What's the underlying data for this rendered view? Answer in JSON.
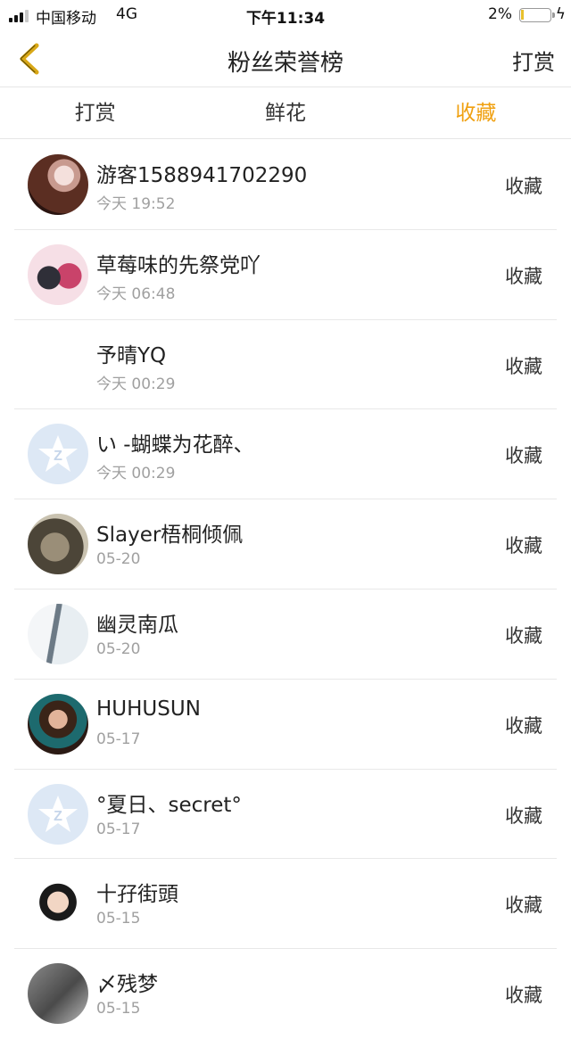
{
  "status_bar": {
    "carrier": "中国移动",
    "network": "4G",
    "time": "下午11:34",
    "battery_percent": "2%",
    "battery_level": 0.02,
    "signal_bars": 3,
    "accent_color": "#e8c02c"
  },
  "header": {
    "back_icon": "chevron-left-icon",
    "back_color": "#d9a817",
    "title": "粉丝荣誉榜",
    "right_action": "打赏"
  },
  "tabs": [
    {
      "label": "打赏",
      "active": false
    },
    {
      "label": "鲜花",
      "active": false
    },
    {
      "label": "收藏",
      "active": true
    }
  ],
  "active_tab_color": "#f0a010",
  "rows": [
    {
      "name": "游客1588941702290",
      "time": "今天 19:52",
      "action": "收藏",
      "avatar": "blossom-photo"
    },
    {
      "name": "草莓味的先祭党吖",
      "time": "今天 06:48",
      "action": "收藏",
      "avatar": "anime-pair"
    },
    {
      "name": "予晴YQ",
      "time": "今天 00:29",
      "action": "收藏",
      "avatar": "none"
    },
    {
      "name": "い -蝴蝶为花醉、",
      "time": "今天 00:29",
      "action": "收藏",
      "avatar": "default-z-star"
    },
    {
      "name": "Slayer梧桐倾佩",
      "time": "05-20",
      "action": "收藏",
      "avatar": "monochrome-photo"
    },
    {
      "name": "幽灵南瓜",
      "time": "05-20",
      "action": "收藏",
      "avatar": "ghost-figure"
    },
    {
      "name": "HUHUSUN",
      "time": "05-17",
      "action": "收藏",
      "avatar": "girl-portrait"
    },
    {
      "name": "°夏日、secret°",
      "time": "05-17",
      "action": "收藏",
      "avatar": "default-z-star"
    },
    {
      "name": "十孖街頭",
      "time": "05-15",
      "action": "收藏",
      "avatar": "face-portrait"
    },
    {
      "name": "〆残梦",
      "time": "05-15",
      "action": "收藏",
      "avatar": "gray-photo"
    }
  ]
}
